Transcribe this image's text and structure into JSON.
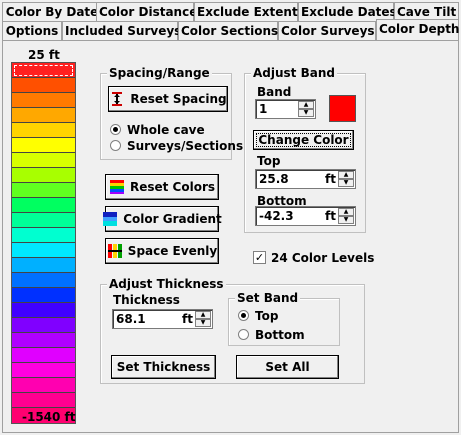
{
  "tabs_row1": [
    {
      "label": "Color By Date"
    },
    {
      "label": "Color Distance"
    },
    {
      "label": "Exclude Extents"
    },
    {
      "label": "Exclude Dates"
    },
    {
      "label": "Cave Tilt"
    }
  ],
  "tabs_row2": [
    {
      "label": "Options"
    },
    {
      "label": "Included Surveys"
    },
    {
      "label": "Color Sections"
    },
    {
      "label": "Color Surveys"
    },
    {
      "label": "Color Depth",
      "active": true
    }
  ],
  "ramp": {
    "top_label": "25 ft",
    "bottom_label": "-1540 ft",
    "selected_band": 1,
    "colors": [
      "#ff2020",
      "#ff5000",
      "#ff7a00",
      "#ffa800",
      "#ffd400",
      "#ffff00",
      "#d8ff00",
      "#a8ff00",
      "#60ff20",
      "#00ff60",
      "#00ff98",
      "#00ffd0",
      "#00e8ff",
      "#00b0ff",
      "#0070ff",
      "#0030ff",
      "#4000ff",
      "#8000ff",
      "#b000ff",
      "#e000ff",
      "#ff00e0",
      "#ff00b0",
      "#ff0090",
      "#ff0070"
    ]
  },
  "spacing": {
    "legend": "Spacing/Range",
    "reset_label": "Reset Spacing",
    "options": [
      {
        "label": "Whole cave",
        "selected": true
      },
      {
        "label": "Surveys/Sections",
        "selected": false
      }
    ]
  },
  "buttons": {
    "reset_colors": "Reset Colors",
    "color_gradient": "Color Gradient",
    "space_evenly": "Space Evenly",
    "change_color": "Change Color",
    "set_thickness": "Set Thickness",
    "set_all": "Set All"
  },
  "adjust_band": {
    "legend": "Adjust Band",
    "band_label": "Band",
    "band_value": "1",
    "band_color": "#ff0000",
    "top_label": "Top",
    "top_value": "25.8",
    "top_unit": "ft",
    "bottom_label": "Bottom",
    "bottom_value": "-42.3",
    "bottom_unit": "ft"
  },
  "color_levels": {
    "label": "24 Color Levels",
    "checked": true,
    "check_glyph": "✓"
  },
  "thickness": {
    "legend": "Adjust Thickness",
    "thickness_label": "Thickness",
    "thickness_value": "68.1",
    "thickness_unit": "ft",
    "set_band_legend": "Set Band",
    "options": [
      {
        "label": "Top",
        "selected": true
      },
      {
        "label": "Bottom",
        "selected": false
      }
    ]
  }
}
